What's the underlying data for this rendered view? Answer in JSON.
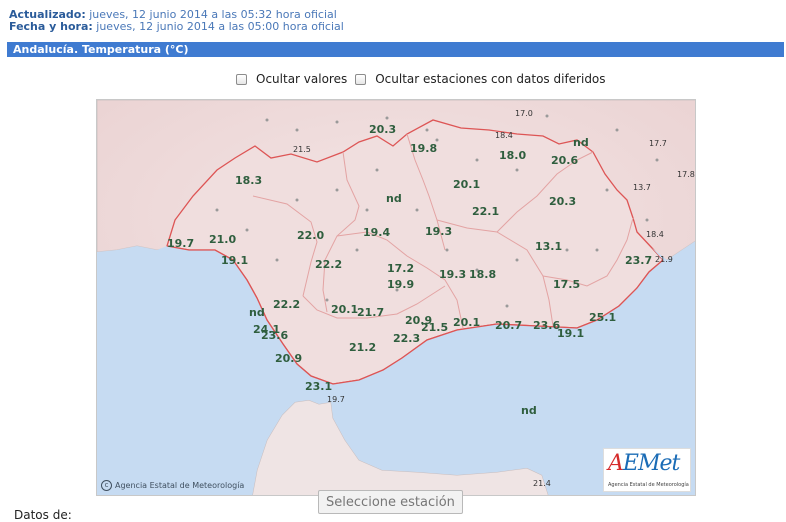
{
  "header": {
    "updated_label": "Actualizado:",
    "updated_value": "jueves, 12 junio 2014 a las 05:32 hora oficial",
    "datetime_label": "Fecha y hora:",
    "datetime_value": "jueves, 12 junio 2014 a las 05:00 hora oficial"
  },
  "title": "Andalucía. Temperatura (°C)",
  "options": {
    "hide_values": "Ocultar valores",
    "hide_deferred": "Ocultar estaciones con datos diferidos"
  },
  "map": {
    "credit": "Agencia Estatal de Meteorología",
    "logo_text": "AEMet",
    "logo_sub": "Agencia Estatal de Meteorología",
    "labels": [
      {
        "v": "17.0",
        "size": "s"
      },
      {
        "v": "20.3",
        "size": "l"
      },
      {
        "v": "18.4",
        "size": "s"
      },
      {
        "v": "nd",
        "size": "l"
      },
      {
        "v": "17.7",
        "size": "s"
      },
      {
        "v": "21.5",
        "size": "s"
      },
      {
        "v": "19.8",
        "size": "l"
      },
      {
        "v": "18.0",
        "size": "l"
      },
      {
        "v": "20.6",
        "size": "l"
      },
      {
        "v": "13.7",
        "size": "s"
      },
      {
        "v": "17.8",
        "size": "s"
      },
      {
        "v": "18.3",
        "size": "l"
      },
      {
        "v": "20.1",
        "size": "l"
      },
      {
        "v": "nd",
        "size": "l"
      },
      {
        "v": "20.3",
        "size": "l"
      },
      {
        "v": "22.1",
        "size": "l"
      },
      {
        "v": "21.0",
        "size": "l"
      },
      {
        "v": "19.7",
        "size": "l"
      },
      {
        "v": "22.0",
        "size": "l"
      },
      {
        "v": "19.4",
        "size": "l"
      },
      {
        "v": "19.3",
        "size": "l"
      },
      {
        "v": "18.4",
        "size": "s"
      },
      {
        "v": "13.1",
        "size": "l"
      },
      {
        "v": "19.1",
        "size": "l"
      },
      {
        "v": "22.2",
        "size": "l"
      },
      {
        "v": "17.2",
        "size": "l"
      },
      {
        "v": "23.7",
        "size": "l"
      },
      {
        "v": "21.9",
        "size": "s"
      },
      {
        "v": "19.3",
        "size": "l"
      },
      {
        "v": "18.8",
        "size": "l"
      },
      {
        "v": "19.9",
        "size": "l"
      },
      {
        "v": "17.5",
        "size": "l"
      },
      {
        "v": "22.2",
        "size": "l"
      },
      {
        "v": "nd",
        "size": "l"
      },
      {
        "v": "20.1",
        "size": "l"
      },
      {
        "v": "21.7",
        "size": "l"
      },
      {
        "v": "25.1",
        "size": "l"
      },
      {
        "v": "20.9",
        "size": "l"
      },
      {
        "v": "20.1",
        "size": "l"
      },
      {
        "v": "20.7",
        "size": "l"
      },
      {
        "v": "23.6",
        "size": "l"
      },
      {
        "v": "24.1",
        "size": "l"
      },
      {
        "v": "21.5",
        "size": "l"
      },
      {
        "v": "19.1",
        "size": "l"
      },
      {
        "v": "23.6",
        "size": "l"
      },
      {
        "v": "22.3",
        "size": "l"
      },
      {
        "v": "21.2",
        "size": "l"
      },
      {
        "v": "20.9",
        "size": "l"
      },
      {
        "v": "23.1",
        "size": "l"
      },
      {
        "v": "19.7",
        "size": "s"
      },
      {
        "v": "nd",
        "size": "l"
      },
      {
        "v": "21.4",
        "size": "s"
      }
    ]
  },
  "station_select": "Seleccione estación",
  "datos_label": "Datos de:"
}
